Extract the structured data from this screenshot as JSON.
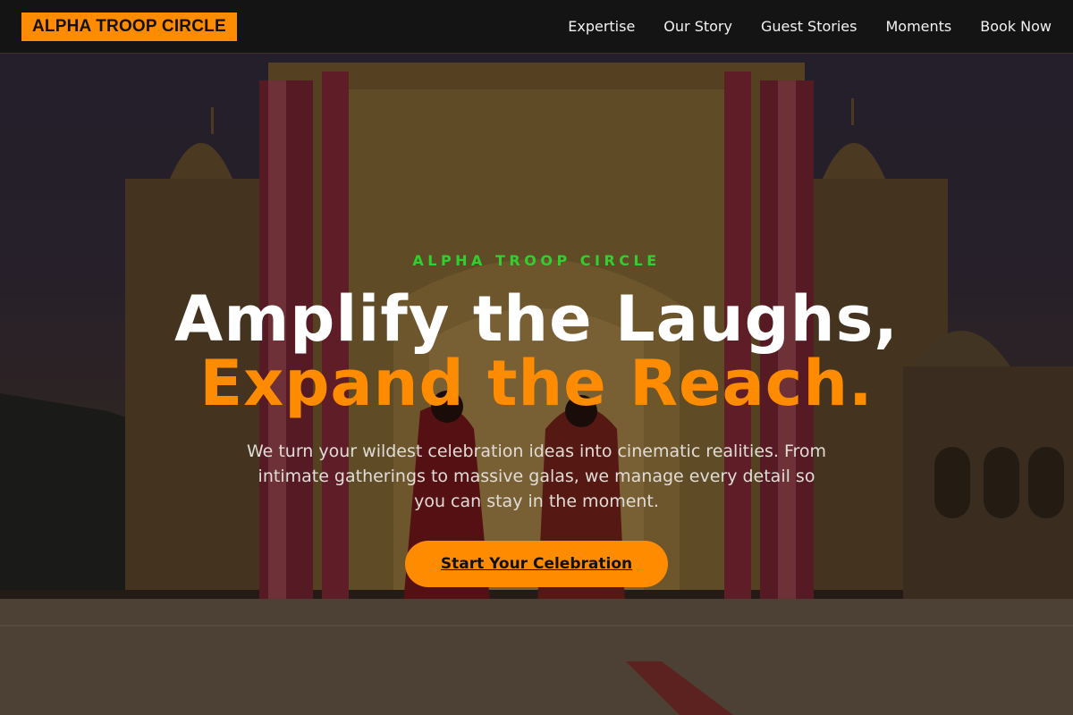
{
  "brand": {
    "logo_text": "ALPHA TROOP CIRCLE"
  },
  "nav": {
    "items": [
      {
        "label": "Expertise"
      },
      {
        "label": "Our Story"
      },
      {
        "label": "Guest Stories"
      },
      {
        "label": "Moments"
      },
      {
        "label": "Book Now"
      }
    ]
  },
  "hero": {
    "eyebrow": "ALPHA TROOP CIRCLE",
    "headline_line1": "Amplify the Laughs,",
    "headline_line2": "Expand the Reach.",
    "subtext": "We turn your wildest celebration ideas into cinematic realities. From intimate gatherings to massive galas, we manage every detail so you can stay in the moment.",
    "cta_label": "Start Your Celebration"
  },
  "colors": {
    "accent": "#ff8c00",
    "eyebrow": "#2fd12f",
    "nav_background": "#141414"
  }
}
